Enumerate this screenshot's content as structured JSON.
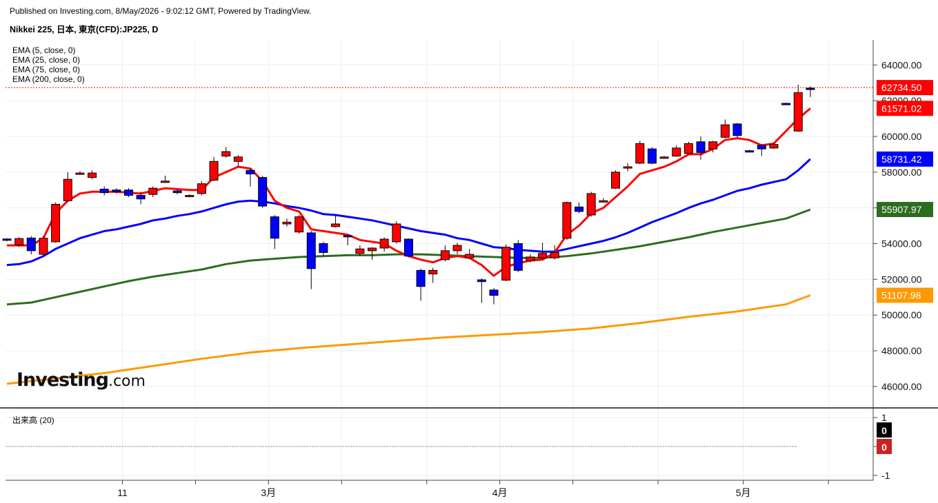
{
  "header": {
    "published": "Published on Investing.com, 8/May/2026 - 9:02:12 GMT, Powered by TradingView.",
    "title": "Nikkei 225, 日本, 東京(CFD):JP225, D"
  },
  "legend": [
    "EMA (5, close, 0)",
    "EMA (25, close, 0)",
    "EMA (75, close, 0)",
    "EMA (200, close, 0)"
  ],
  "volume_label": "出来高 (20)",
  "logo": {
    "main": "Investing",
    "suffix": ".com"
  },
  "colors": {
    "up": "#ff0000",
    "down": "#0000ff",
    "ema5": "#ff0000",
    "ema25": "#0000ff",
    "ema75": "#2e6b1f",
    "ema200": "#ff9900",
    "last_price": "#ff0000"
  },
  "chart_data": {
    "type": "candlestick",
    "ylim": [
      44800,
      65400
    ],
    "y_ticks": [
      46000,
      48000,
      50000,
      52000,
      54000,
      56000,
      58000,
      60000,
      62000,
      64000
    ],
    "x_labels": [
      {
        "label": "11",
        "day": 10
      },
      {
        "label": "3月",
        "day": 22
      },
      {
        "label": "4月",
        "day": 41
      },
      {
        "label": "5月",
        "day": 61
      }
    ],
    "days": 67,
    "candles": [
      [
        54260,
        54200,
        54300,
        54120
      ],
      [
        53930,
        54280,
        54360,
        53820
      ],
      [
        54310,
        53600,
        54420,
        53400
      ],
      [
        53400,
        54300,
        54420,
        53350
      ],
      [
        54100,
        56200,
        56300,
        54050
      ],
      [
        56400,
        57600,
        58000,
        56350
      ],
      [
        57900,
        57950,
        58050,
        57850
      ],
      [
        57700,
        57950,
        58100,
        57600
      ],
      [
        57050,
        56850,
        57200,
        56700
      ],
      [
        57000,
        56900,
        57100,
        56800
      ],
      [
        57000,
        56700,
        57100,
        56600
      ],
      [
        56700,
        56500,
        56900,
        56200
      ],
      [
        56750,
        57100,
        57200,
        56600
      ],
      [
        57450,
        57500,
        57800,
        57400
      ],
      [
        56950,
        56850,
        57000,
        56750
      ],
      [
        56700,
        56700,
        56750,
        56650
      ],
      [
        56800,
        57350,
        57500,
        56700
      ],
      [
        57550,
        58600,
        58850,
        57500
      ],
      [
        58900,
        59150,
        59400,
        58800
      ],
      [
        58600,
        58850,
        58950,
        58300
      ],
      [
        58100,
        57900,
        58200,
        57200
      ],
      [
        57700,
        56100,
        57800,
        56000
      ],
      [
        55500,
        54300,
        55600,
        53700
      ],
      [
        55100,
        55200,
        55400,
        54950
      ],
      [
        54650,
        55500,
        55600,
        54550
      ],
      [
        54600,
        52600,
        54700,
        51450
      ],
      [
        54000,
        53500,
        54100,
        53300
      ],
      [
        54950,
        55100,
        55600,
        54900
      ],
      [
        54450,
        54400,
        54500,
        53900
      ],
      [
        53450,
        53700,
        53900,
        53300
      ],
      [
        53600,
        53750,
        53800,
        53100
      ],
      [
        53750,
        54250,
        54350,
        53550
      ],
      [
        54100,
        55100,
        55250,
        54000
      ],
      [
        54250,
        53300,
        54300,
        53250
      ],
      [
        52500,
        51600,
        52600,
        50800
      ],
      [
        52300,
        52500,
        52650,
        51800
      ],
      [
        53100,
        53600,
        53900,
        53000
      ],
      [
        53600,
        53900,
        54050,
        53400
      ],
      [
        53200,
        53400,
        53700,
        53150
      ],
      [
        51970,
        51870,
        52060,
        50680
      ],
      [
        51400,
        51100,
        51500,
        50600
      ],
      [
        51950,
        53800,
        53950,
        51900
      ],
      [
        54000,
        52500,
        54200,
        52400
      ],
      [
        53050,
        53250,
        53400,
        52950
      ],
      [
        53200,
        53450,
        54050,
        53100
      ],
      [
        53200,
        53500,
        53900,
        53100
      ],
      [
        54300,
        56300,
        56350,
        54200
      ],
      [
        56050,
        55800,
        56300,
        55700
      ],
      [
        55600,
        56800,
        56900,
        55500
      ],
      [
        56400,
        56400,
        56550,
        56300
      ],
      [
        57100,
        58000,
        58100,
        57050
      ],
      [
        58250,
        58300,
        58500,
        58050
      ],
      [
        58500,
        59600,
        59750,
        58450
      ],
      [
        59300,
        58500,
        59400,
        58450
      ],
      [
        58800,
        58850,
        58900,
        58750
      ],
      [
        58900,
        59350,
        59500,
        58850
      ],
      [
        59050,
        59600,
        59700,
        59000
      ],
      [
        59700,
        59100,
        60000,
        58700
      ],
      [
        59300,
        59700,
        59750,
        59100
      ],
      [
        59950,
        60650,
        60950,
        59900
      ],
      [
        60700,
        60050,
        60750,
        59950
      ],
      [
        59200,
        59150,
        59250,
        59100
      ],
      [
        59500,
        59300,
        59550,
        58900
      ],
      [
        59350,
        59550,
        59650,
        59300
      ],
      [
        61850,
        61800,
        61900,
        61750
      ],
      [
        60300,
        62450,
        62900,
        60250
      ],
      [
        62700,
        62650,
        62800,
        62200
      ]
    ],
    "ema5": [
      [
        0,
        53900
      ],
      [
        2,
        53900
      ],
      [
        3,
        54300
      ],
      [
        4,
        55700
      ],
      [
        5,
        56400
      ],
      [
        6,
        56800
      ],
      [
        7,
        56900
      ],
      [
        9,
        56900
      ],
      [
        11,
        56800
      ],
      [
        13,
        57100
      ],
      [
        15,
        57000
      ],
      [
        16,
        57000
      ],
      [
        17,
        57700
      ],
      [
        18,
        58000
      ],
      [
        19,
        58300
      ],
      [
        20,
        58200
      ],
      [
        21,
        57500
      ],
      [
        22,
        56400
      ],
      [
        23,
        56000
      ],
      [
        24,
        55800
      ],
      [
        25,
        54800
      ],
      [
        26,
        54700
      ],
      [
        27,
        54600
      ],
      [
        28,
        54500
      ],
      [
        29,
        54200
      ],
      [
        31,
        54000
      ],
      [
        32,
        53600
      ],
      [
        33,
        53300
      ],
      [
        34,
        53100
      ],
      [
        35,
        52950
      ],
      [
        36,
        53200
      ],
      [
        37,
        53300
      ],
      [
        38,
        53200
      ],
      [
        39,
        52800
      ],
      [
        40,
        52200
      ],
      [
        41,
        52700
      ],
      [
        42,
        52900
      ],
      [
        43,
        53050
      ],
      [
        44,
        53100
      ],
      [
        45,
        53500
      ],
      [
        46,
        54500
      ],
      [
        47,
        55000
      ],
      [
        48,
        55700
      ],
      [
        49,
        56000
      ],
      [
        50,
        56600
      ],
      [
        51,
        57200
      ],
      [
        52,
        57900
      ],
      [
        53,
        58100
      ],
      [
        54,
        58300
      ],
      [
        55,
        58600
      ],
      [
        56,
        59000
      ],
      [
        57,
        59000
      ],
      [
        58,
        59300
      ],
      [
        59,
        59800
      ],
      [
        60,
        59900
      ],
      [
        61,
        59800
      ],
      [
        62,
        59500
      ],
      [
        63,
        59600
      ],
      [
        64,
        60300
      ],
      [
        65,
        61000
      ],
      [
        66,
        61571
      ]
    ],
    "ema25": [
      [
        0,
        52800
      ],
      [
        1,
        52850
      ],
      [
        2,
        53000
      ],
      [
        3,
        53300
      ],
      [
        4,
        53700
      ],
      [
        5,
        54000
      ],
      [
        6,
        54300
      ],
      [
        7,
        54500
      ],
      [
        8,
        54700
      ],
      [
        9,
        54800
      ],
      [
        10,
        54950
      ],
      [
        11,
        55100
      ],
      [
        12,
        55300
      ],
      [
        13,
        55400
      ],
      [
        14,
        55550
      ],
      [
        15,
        55650
      ],
      [
        16,
        55800
      ],
      [
        17,
        56000
      ],
      [
        18,
        56200
      ],
      [
        19,
        56350
      ],
      [
        20,
        56400
      ],
      [
        21,
        56350
      ],
      [
        22,
        56250
      ],
      [
        23,
        56100
      ],
      [
        24,
        56000
      ],
      [
        25,
        55850
      ],
      [
        26,
        55650
      ],
      [
        27,
        55600
      ],
      [
        28,
        55500
      ],
      [
        29,
        55400
      ],
      [
        30,
        55300
      ],
      [
        31,
        55150
      ],
      [
        32,
        55000
      ],
      [
        33,
        54850
      ],
      [
        34,
        54700
      ],
      [
        35,
        54600
      ],
      [
        36,
        54500
      ],
      [
        37,
        54300
      ],
      [
        38,
        54200
      ],
      [
        39,
        54000
      ],
      [
        40,
        53800
      ],
      [
        41,
        53750
      ],
      [
        42,
        53650
      ],
      [
        43,
        53600
      ],
      [
        44,
        53550
      ],
      [
        45,
        53550
      ],
      [
        46,
        53700
      ],
      [
        47,
        53850
      ],
      [
        48,
        54000
      ],
      [
        49,
        54150
      ],
      [
        50,
        54350
      ],
      [
        51,
        54600
      ],
      [
        52,
        54900
      ],
      [
        53,
        55200
      ],
      [
        54,
        55450
      ],
      [
        55,
        55700
      ],
      [
        56,
        56000
      ],
      [
        57,
        56250
      ],
      [
        58,
        56450
      ],
      [
        59,
        56700
      ],
      [
        60,
        56950
      ],
      [
        61,
        57100
      ],
      [
        62,
        57300
      ],
      [
        63,
        57450
      ],
      [
        64,
        57600
      ],
      [
        65,
        58100
      ],
      [
        66,
        58731
      ]
    ],
    "ema75": [
      [
        0,
        50600
      ],
      [
        2,
        50700
      ],
      [
        4,
        51000
      ],
      [
        6,
        51300
      ],
      [
        8,
        51600
      ],
      [
        10,
        51900
      ],
      [
        12,
        52150
      ],
      [
        14,
        52350
      ],
      [
        16,
        52550
      ],
      [
        18,
        52850
      ],
      [
        20,
        53050
      ],
      [
        22,
        53150
      ],
      [
        24,
        53250
      ],
      [
        26,
        53300
      ],
      [
        28,
        53350
      ],
      [
        30,
        53350
      ],
      [
        32,
        53400
      ],
      [
        34,
        53400
      ],
      [
        36,
        53350
      ],
      [
        38,
        53300
      ],
      [
        40,
        53250
      ],
      [
        42,
        53200
      ],
      [
        44,
        53200
      ],
      [
        46,
        53300
      ],
      [
        48,
        53450
      ],
      [
        50,
        53650
      ],
      [
        52,
        53850
      ],
      [
        54,
        54100
      ],
      [
        56,
        54350
      ],
      [
        58,
        54650
      ],
      [
        60,
        54900
      ],
      [
        62,
        55150
      ],
      [
        64,
        55400
      ],
      [
        66,
        55908
      ]
    ],
    "ema200": [
      [
        0,
        46150
      ],
      [
        4,
        46450
      ],
      [
        8,
        46750
      ],
      [
        12,
        47150
      ],
      [
        16,
        47550
      ],
      [
        20,
        47900
      ],
      [
        24,
        48150
      ],
      [
        28,
        48350
      ],
      [
        32,
        48550
      ],
      [
        36,
        48750
      ],
      [
        40,
        48900
      ],
      [
        44,
        49050
      ],
      [
        48,
        49250
      ],
      [
        52,
        49550
      ],
      [
        56,
        49900
      ],
      [
        60,
        50200
      ],
      [
        64,
        50600
      ],
      [
        66,
        51108
      ]
    ],
    "last_price": {
      "value": 62734.5,
      "label": "62734.50"
    },
    "price_tags": [
      {
        "label": "62734.50",
        "value": 62734.5,
        "color": "#ff0000"
      },
      {
        "label": "61571.02",
        "value": 61571.02,
        "color": "#ff0000"
      },
      {
        "label": "58731.42",
        "value": 58731.42,
        "color": "#0000ff"
      },
      {
        "label": "55907.97",
        "value": 55907.97,
        "color": "#2e6b1f"
      },
      {
        "label": "51107.98",
        "value": 51107.98,
        "color": "#ff9900"
      }
    ],
    "volume": {
      "ylim": [
        -1,
        1
      ],
      "ticks": [
        "1",
        "0",
        "-1"
      ],
      "tick_values": [
        1,
        0,
        -1
      ],
      "tags": [
        {
          "label": "0",
          "color": "#000000"
        },
        {
          "label": "0",
          "color": "#cc2222"
        }
      ]
    }
  }
}
